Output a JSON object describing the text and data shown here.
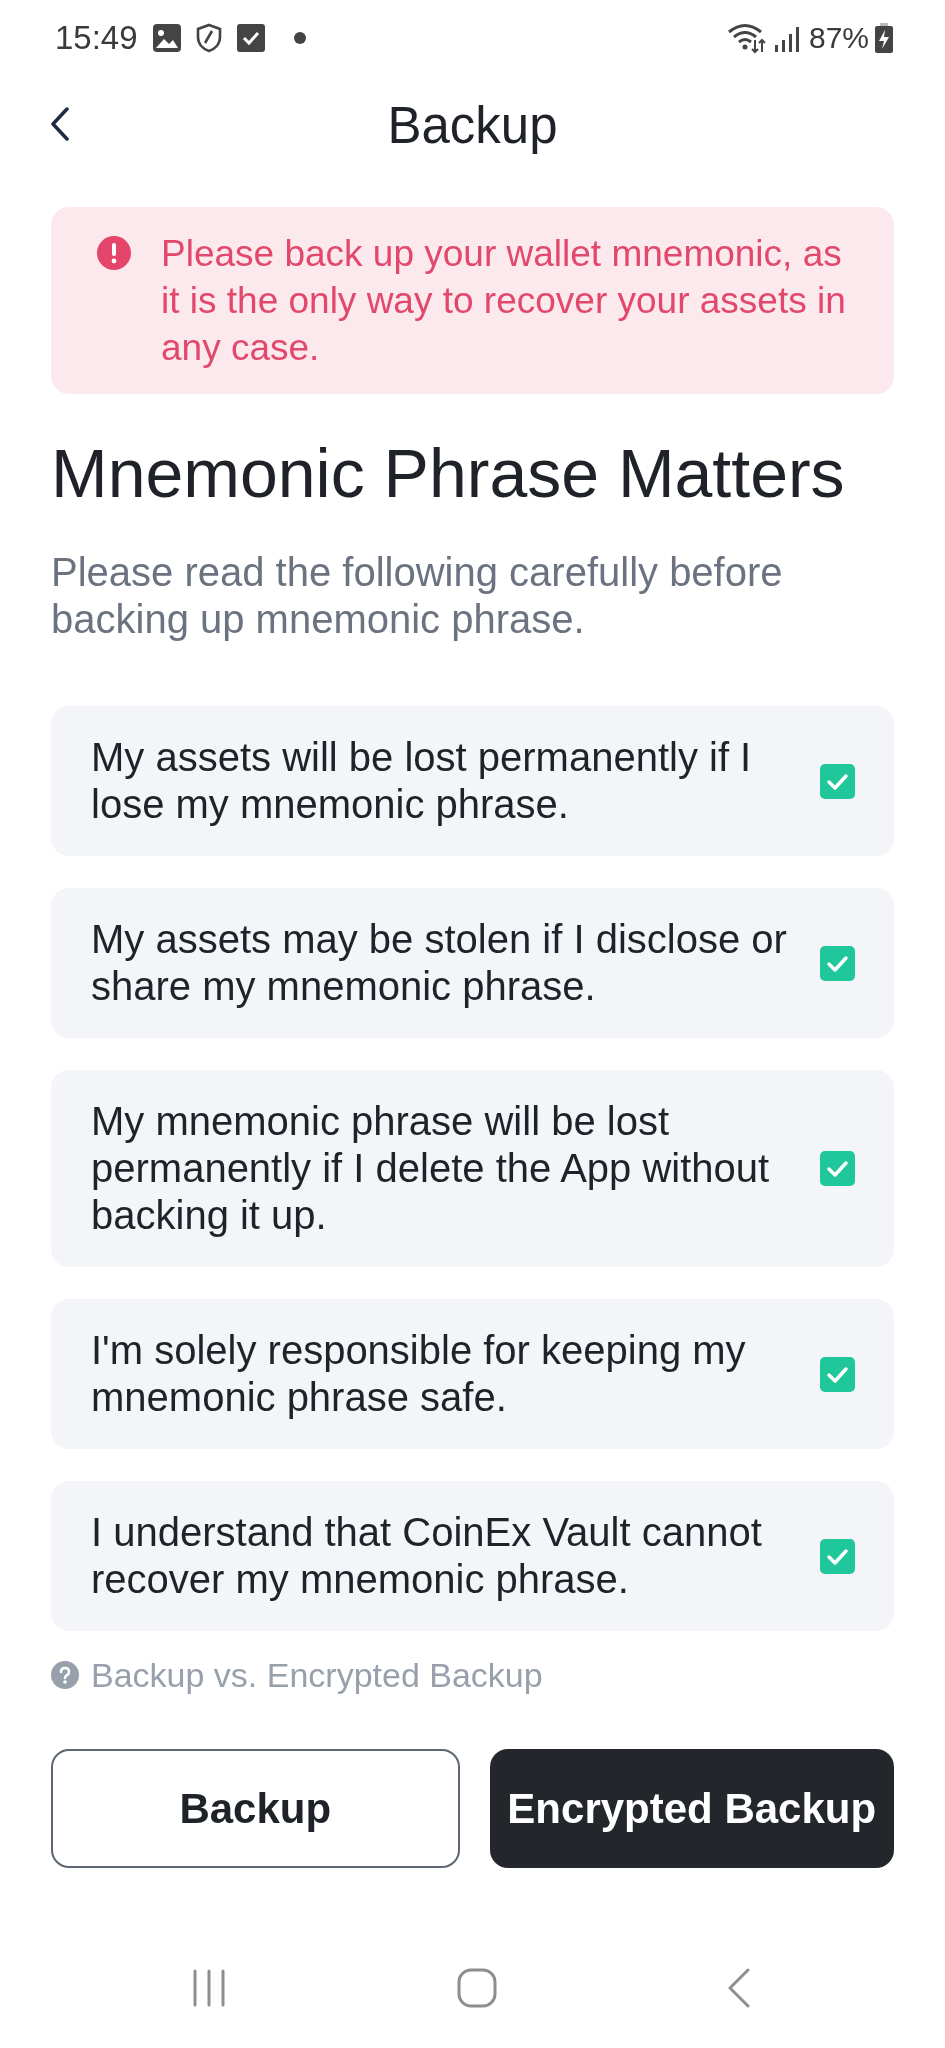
{
  "status_bar": {
    "time": "15:49",
    "battery": "87%"
  },
  "header": {
    "title": "Backup"
  },
  "alert": {
    "message": "Please back up your wallet mnemonic, as it is the only way to recover your assets in any case."
  },
  "heading": "Mnemonic Phrase Matters",
  "subtitle": "Please read the following carefully before backing up mnemonic phrase.",
  "checklist": [
    {
      "text": "My assets will be lost permanently if I lose my mnemonic phrase.",
      "checked": true
    },
    {
      "text": "My assets may be stolen if I disclose or share my mnemonic phrase.",
      "checked": true
    },
    {
      "text": "My mnemonic phrase will be lost permanently if I delete the App without backing it up.",
      "checked": true
    },
    {
      "text": "I'm solely responsible for keeping my mnemonic phrase safe.",
      "checked": true
    },
    {
      "text": "I understand that CoinEx Vault cannot recover my mnemonic phrase.",
      "checked": true
    }
  ],
  "help_link": {
    "label": "Backup vs. Encrypted Backup"
  },
  "buttons": [
    {
      "label": "Backup",
      "kind": "outline"
    },
    {
      "label": "Encrypted Backup",
      "kind": "filled"
    }
  ]
}
